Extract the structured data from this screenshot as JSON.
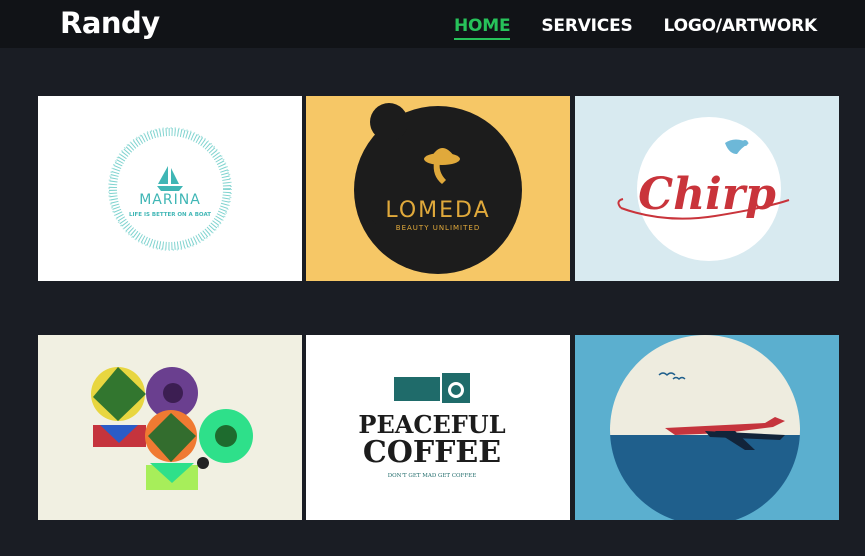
{
  "brand": {
    "name": "Randy"
  },
  "nav": {
    "items": [
      "HOME",
      "SERVICES",
      "LOGO/ARTWORK"
    ],
    "active": "HOME"
  },
  "colors": {
    "accent": "#27c25a",
    "background": "#1a1d24",
    "topbar": "#111317"
  },
  "portfolio": {
    "items": [
      {
        "name": "Marina",
        "title": "MARINA",
        "tagline": "LIFE IS BETTER ON A BOAT",
        "bg": "#ffffff"
      },
      {
        "name": "Lomeda",
        "title": "LOMEDA",
        "tagline": "BEAUTY UNLIMITED",
        "bg": "#f6c766"
      },
      {
        "name": "Chirp",
        "title": "Chirp",
        "bg": "#d8eaf0"
      },
      {
        "name": "Geometric shapes",
        "bg": "#f1f0e2"
      },
      {
        "name": "Peaceful Coffee",
        "title_line1": "PEACEFUL",
        "title_line2": "COFFEE",
        "tagline": "DON'T GET MAD GET COFFEE",
        "bg": "#ffffff"
      },
      {
        "name": "Airplane",
        "bg": "#5bafcf"
      }
    ]
  }
}
